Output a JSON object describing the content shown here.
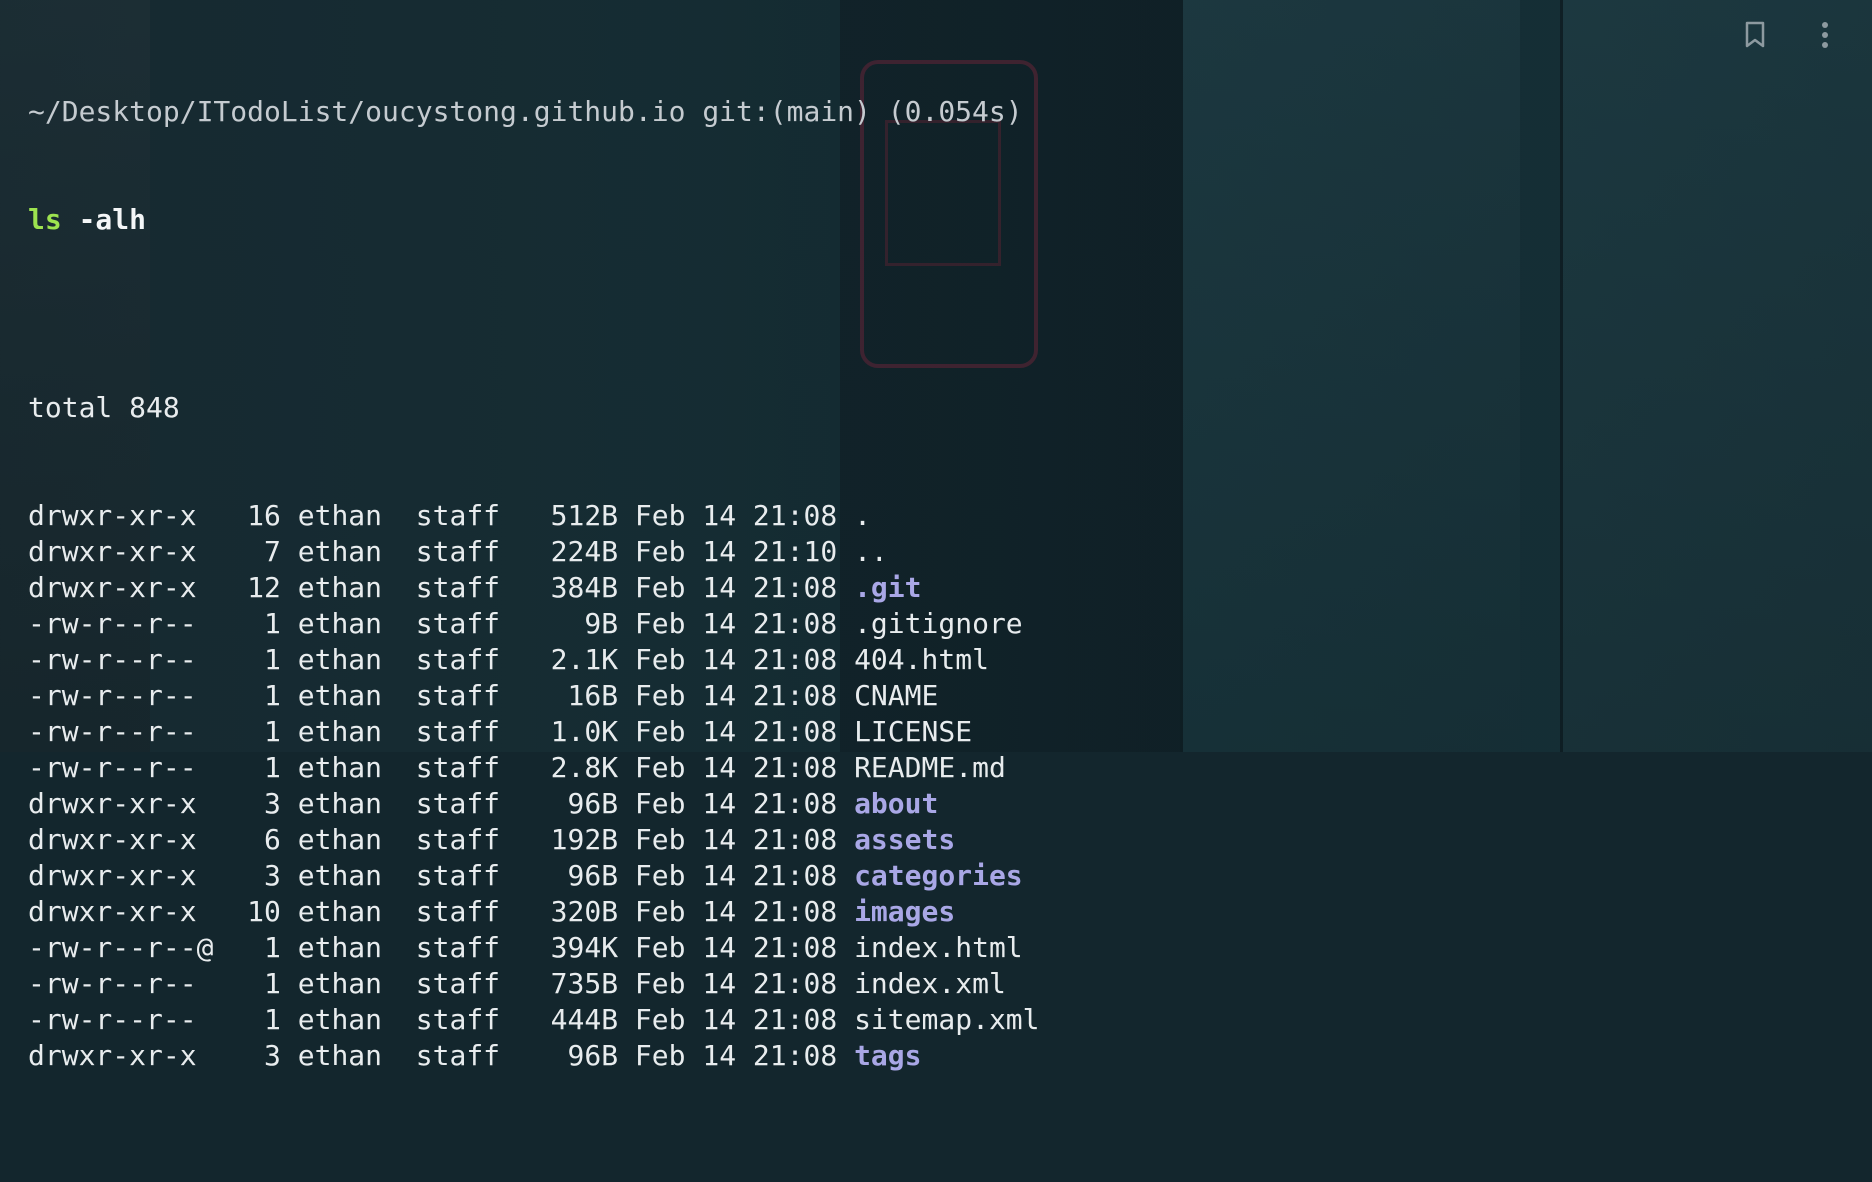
{
  "prompt": {
    "path": "~/Desktop/ITodoList/oucystong.github.io",
    "git": "git:(main)",
    "elapsed": "(0.054s)"
  },
  "command": {
    "name": "ls",
    "args": "-alh"
  },
  "total": "total 848",
  "entries": [
    {
      "perm": "drwxr-xr-x ",
      "links": "16",
      "owner": "ethan",
      "group": "staff",
      "size": "512B",
      "date": "Feb 14 21:08",
      "name": ".",
      "is_dir": false
    },
    {
      "perm": "drwxr-xr-x ",
      "links": " 7",
      "owner": "ethan",
      "group": "staff",
      "size": "224B",
      "date": "Feb 14 21:10",
      "name": "..",
      "is_dir": false
    },
    {
      "perm": "drwxr-xr-x ",
      "links": "12",
      "owner": "ethan",
      "group": "staff",
      "size": "384B",
      "date": "Feb 14 21:08",
      "name": ".git",
      "is_dir": true
    },
    {
      "perm": "-rw-r--r-- ",
      "links": " 1",
      "owner": "ethan",
      "group": "staff",
      "size": "  9B",
      "date": "Feb 14 21:08",
      "name": ".gitignore",
      "is_dir": false
    },
    {
      "perm": "-rw-r--r-- ",
      "links": " 1",
      "owner": "ethan",
      "group": "staff",
      "size": "2.1K",
      "date": "Feb 14 21:08",
      "name": "404.html",
      "is_dir": false
    },
    {
      "perm": "-rw-r--r-- ",
      "links": " 1",
      "owner": "ethan",
      "group": "staff",
      "size": " 16B",
      "date": "Feb 14 21:08",
      "name": "CNAME",
      "is_dir": false
    },
    {
      "perm": "-rw-r--r-- ",
      "links": " 1",
      "owner": "ethan",
      "group": "staff",
      "size": "1.0K",
      "date": "Feb 14 21:08",
      "name": "LICENSE",
      "is_dir": false
    },
    {
      "perm": "-rw-r--r-- ",
      "links": " 1",
      "owner": "ethan",
      "group": "staff",
      "size": "2.8K",
      "date": "Feb 14 21:08",
      "name": "README.md",
      "is_dir": false
    },
    {
      "perm": "drwxr-xr-x ",
      "links": " 3",
      "owner": "ethan",
      "group": "staff",
      "size": " 96B",
      "date": "Feb 14 21:08",
      "name": "about",
      "is_dir": true
    },
    {
      "perm": "drwxr-xr-x ",
      "links": " 6",
      "owner": "ethan",
      "group": "staff",
      "size": "192B",
      "date": "Feb 14 21:08",
      "name": "assets",
      "is_dir": true
    },
    {
      "perm": "drwxr-xr-x ",
      "links": " 3",
      "owner": "ethan",
      "group": "staff",
      "size": " 96B",
      "date": "Feb 14 21:08",
      "name": "categories",
      "is_dir": true
    },
    {
      "perm": "drwxr-xr-x ",
      "links": "10",
      "owner": "ethan",
      "group": "staff",
      "size": "320B",
      "date": "Feb 14 21:08",
      "name": "images",
      "is_dir": true
    },
    {
      "perm": "-rw-r--r--@",
      "links": " 1",
      "owner": "ethan",
      "group": "staff",
      "size": "394K",
      "date": "Feb 14 21:08",
      "name": "index.html",
      "is_dir": false
    },
    {
      "perm": "-rw-r--r-- ",
      "links": " 1",
      "owner": "ethan",
      "group": "staff",
      "size": "735B",
      "date": "Feb 14 21:08",
      "name": "index.xml",
      "is_dir": false
    },
    {
      "perm": "-rw-r--r-- ",
      "links": " 1",
      "owner": "ethan",
      "group": "staff",
      "size": "444B",
      "date": "Feb 14 21:08",
      "name": "sitemap.xml",
      "is_dir": false
    },
    {
      "perm": "drwxr-xr-x ",
      "links": " 3",
      "owner": "ethan",
      "group": "staff",
      "size": " 96B",
      "date": "Feb 14 21:08",
      "name": "tags",
      "is_dir": true
    }
  ],
  "toolbar": {
    "bookmark_icon": "bookmark-icon",
    "more_icon": "more-vertical-icon"
  },
  "colors": {
    "command": "#9de34f",
    "directory": "#a9a7e6",
    "text": "#e8ecee"
  }
}
